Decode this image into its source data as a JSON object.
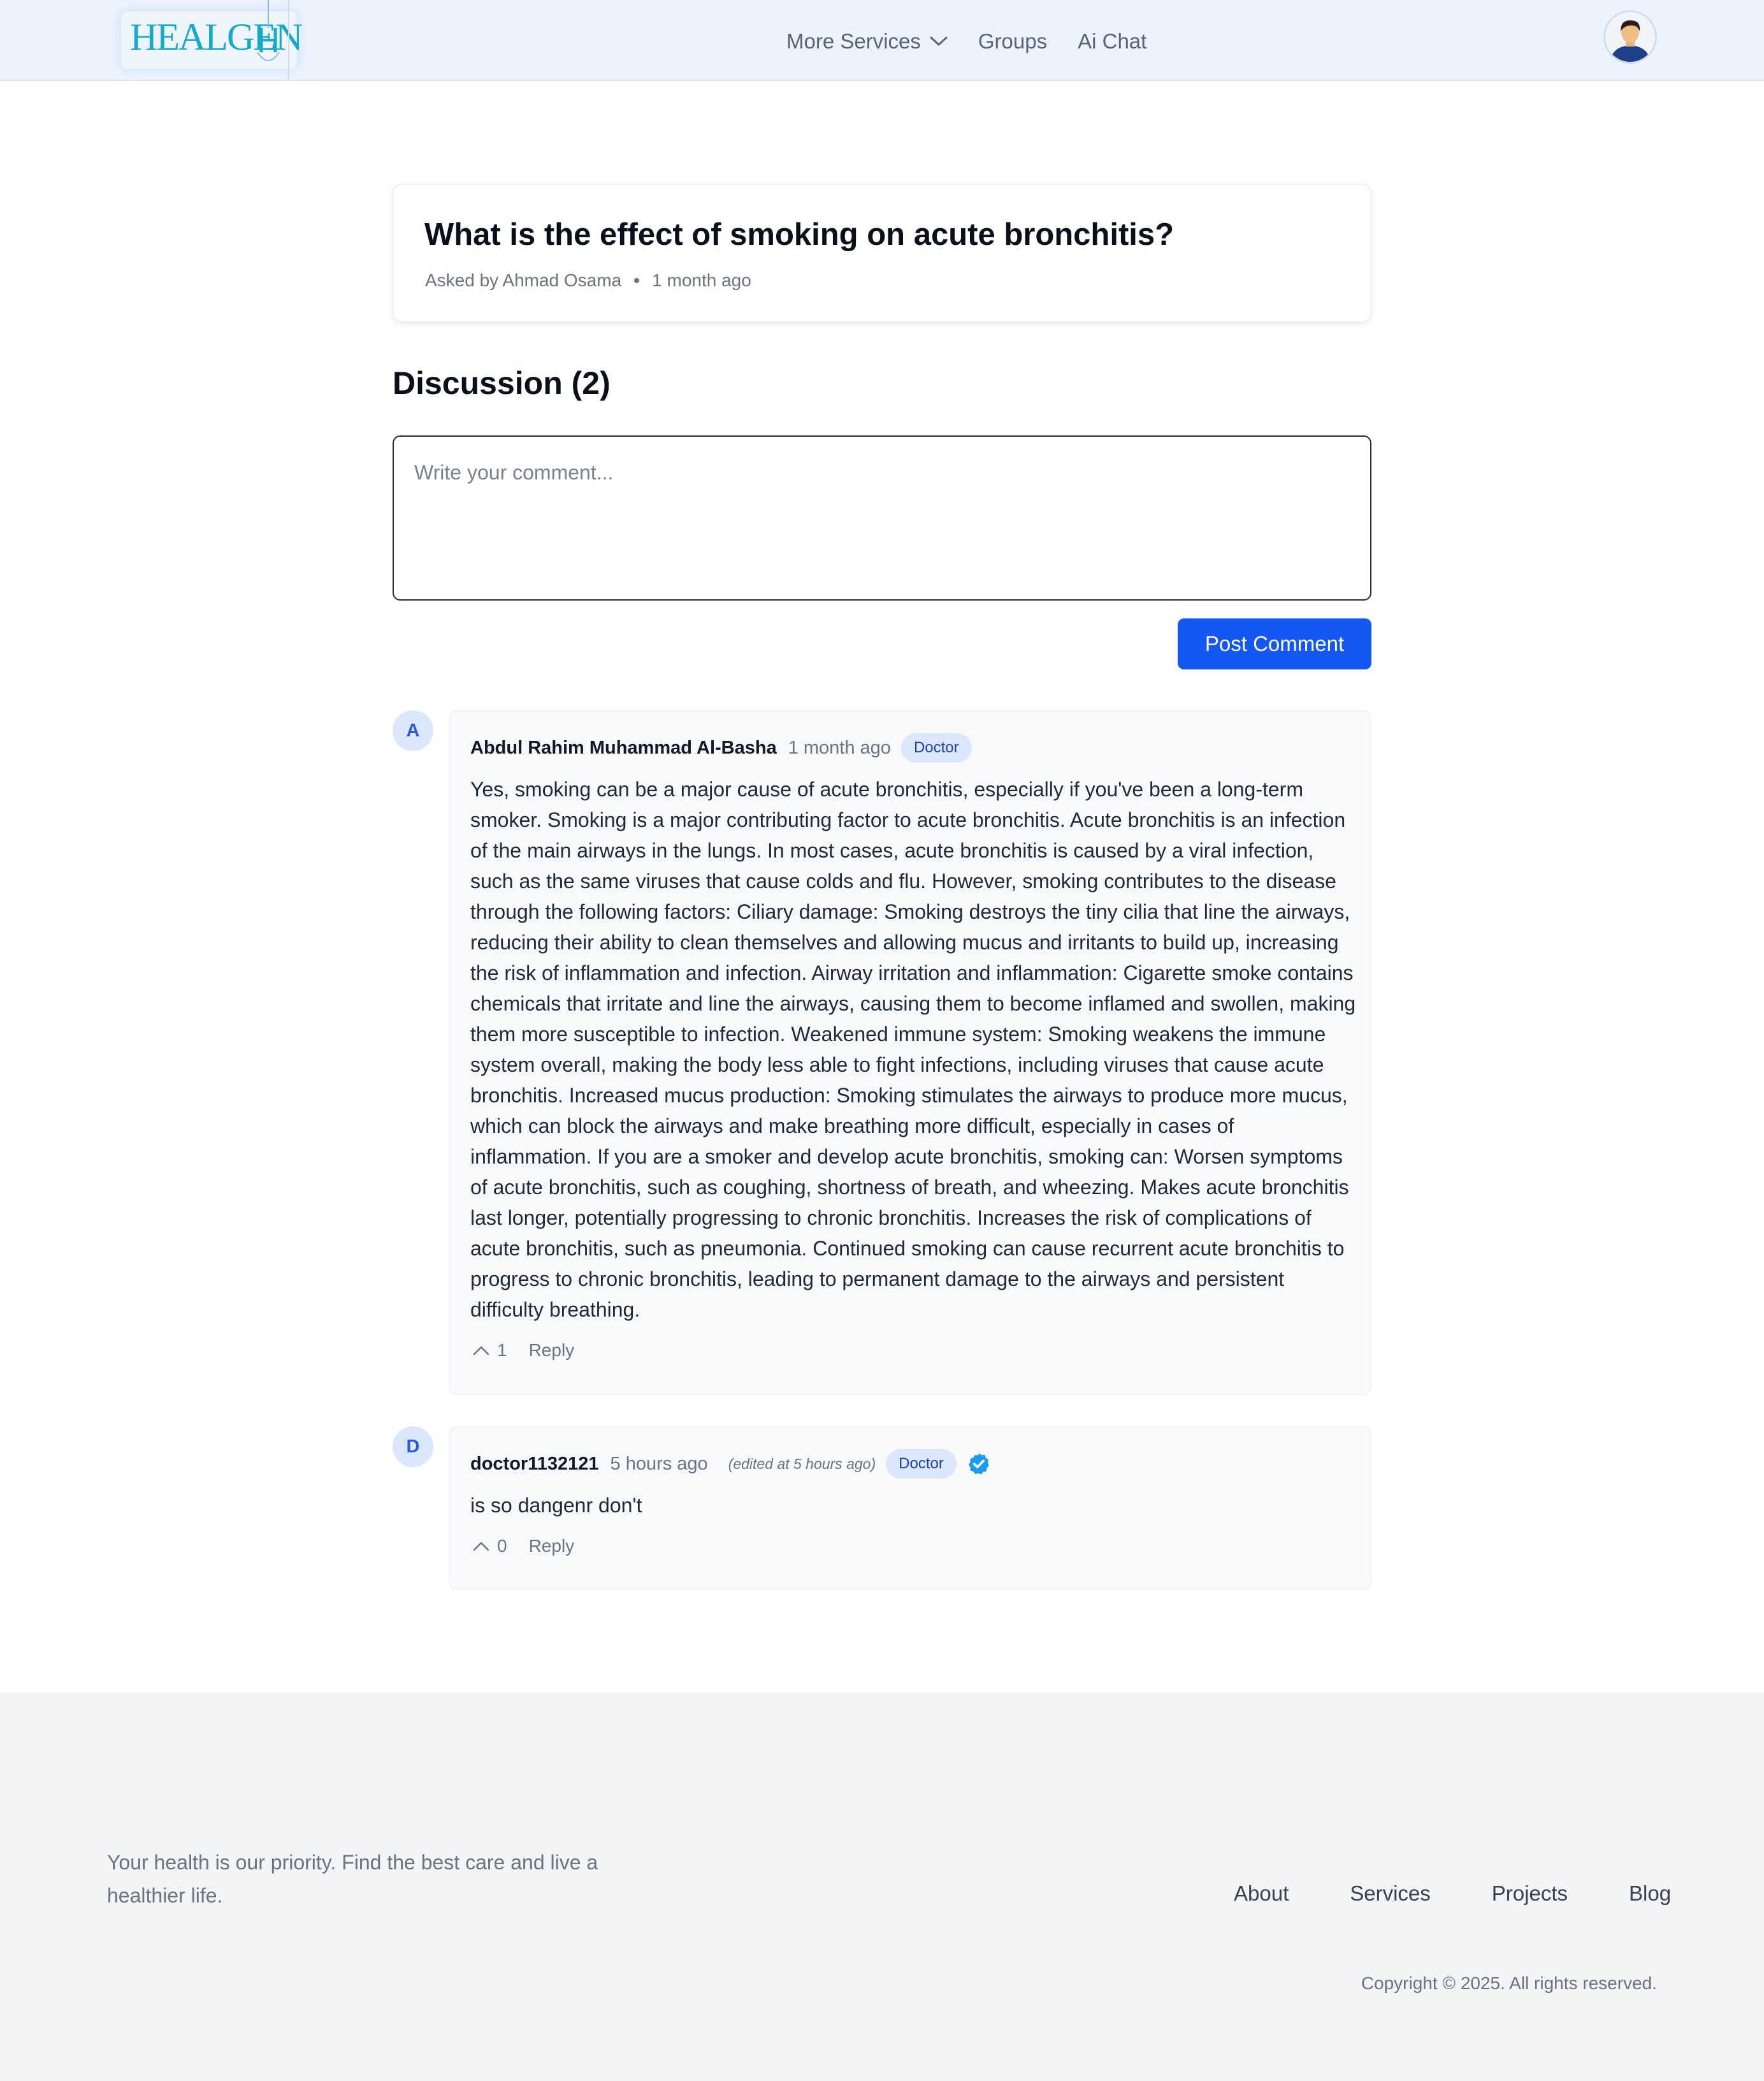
{
  "header": {
    "logo_text": "HEALGEN",
    "nav": {
      "more_services": "More Services",
      "groups": "Groups",
      "ai_chat": "Ai Chat"
    }
  },
  "question": {
    "title": "What is the effect of smoking on acute bronchitis?",
    "asked_by": "Asked by Ahmad Osama",
    "time": "1 month ago"
  },
  "discussion": {
    "title": "Discussion (2)",
    "input_placeholder": "Write your comment...",
    "post_button": "Post Comment"
  },
  "comments": [
    {
      "initial": "A",
      "author": "Abdul Rahim Muhammad Al-Basha",
      "time": "1 month ago",
      "edited": "",
      "badge": "Doctor",
      "verified": false,
      "body": "Yes, smoking can be a major cause of acute bronchitis, especially if you've been a long-term smoker. Smoking is a major contributing factor to acute bronchitis. Acute bronchitis is an infection of the main airways in the lungs. In most cases, acute bronchitis is caused by a viral infection, such as the same viruses that cause colds and flu. However, smoking contributes to the disease through the following factors: Ciliary damage: Smoking destroys the tiny cilia that line the airways, reducing their ability to clean themselves and allowing mucus and irritants to build up, increasing the risk of inflammation and infection. Airway irritation and inflammation: Cigarette smoke contains chemicals that irritate and line the airways, causing them to become inflamed and swollen, making them more susceptible to infection. Weakened immune system: Smoking weakens the immune system overall, making the body less able to fight infections, including viruses that cause acute bronchitis. Increased mucus production: Smoking stimulates the airways to produce more mucus, which can block the airways and make breathing more difficult, especially in cases of inflammation. If you are a smoker and develop acute bronchitis, smoking can: Worsen symptoms of acute bronchitis, such as coughing, shortness of breath, and wheezing. Makes acute bronchitis last longer, potentially progressing to chronic bronchitis. Increases the risk of complications of acute bronchitis, such as pneumonia. Continued smoking can cause recurrent acute bronchitis to progress to chronic bronchitis, leading to permanent damage to the airways and persistent difficulty breathing.",
      "votes": "1",
      "reply": "Reply"
    },
    {
      "initial": "D",
      "author": "doctor1132121",
      "time": "5 hours ago",
      "edited": "(edited at 5 hours ago)",
      "badge": "Doctor",
      "verified": true,
      "body": "is so dangenr don't",
      "votes": "0",
      "reply": "Reply"
    }
  ],
  "footer": {
    "tagline": "Your health is our priority. Find the best care and live a healthier life.",
    "links": [
      "About",
      "Services",
      "Projects",
      "Blog"
    ],
    "copyright": "Copyright © 2025. All rights reserved."
  },
  "colors": {
    "header_bg": "#eaf3fe",
    "primary_button": "#1557f5",
    "badge_bg": "#dbe7fb",
    "verified": "#1d9bf0",
    "footer_bg": "#f3f4f6"
  },
  "icons": [
    "chevron-down-icon",
    "user-avatar",
    "upvote-icon",
    "verified-icon"
  ]
}
